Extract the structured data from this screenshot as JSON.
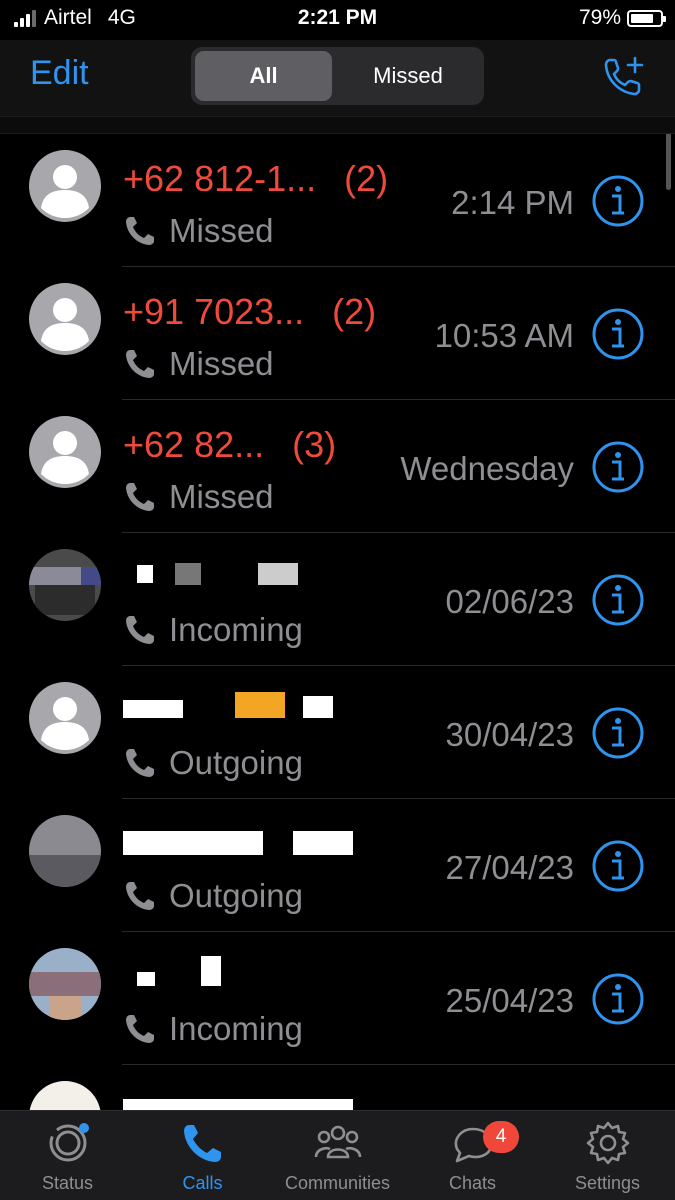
{
  "status_bar": {
    "carrier": "Airtel",
    "network": "4G",
    "time": "2:21 PM",
    "battery": "79%",
    "battery_level": 0.79
  },
  "header": {
    "edit_label": "Edit",
    "segments": [
      "All",
      "Missed"
    ],
    "selected_segment": "All",
    "new_call_icon": "add-call-icon"
  },
  "calls": [
    {
      "name": "+62 812-1...",
      "count": "(2)",
      "type": "Missed",
      "time": "2:14 PM",
      "missed": true
    },
    {
      "name": "+91 7023...",
      "count": "(2)",
      "type": "Missed",
      "time": "10:53 AM",
      "missed": true
    },
    {
      "name": "+62 82...",
      "count": "(3)",
      "type": "Missed",
      "time": "Wednesday",
      "missed": true
    },
    {
      "name": "",
      "count": "",
      "type": "Incoming",
      "time": "02/06/23",
      "missed": false
    },
    {
      "name": "",
      "count": "",
      "type": "Outgoing",
      "time": "30/04/23",
      "missed": false
    },
    {
      "name": "",
      "count": "",
      "type": "Outgoing",
      "time": "27/04/23",
      "missed": false
    },
    {
      "name": "",
      "count": "",
      "type": "Incoming",
      "time": "25/04/23",
      "missed": false
    }
  ],
  "tabs": [
    {
      "label": "Status",
      "icon": "status-icon"
    },
    {
      "label": "Calls",
      "icon": "phone-icon",
      "active": true
    },
    {
      "label": "Communities",
      "icon": "communities-icon"
    },
    {
      "label": "Chats",
      "icon": "chats-icon",
      "badge": "4"
    },
    {
      "label": "Settings",
      "icon": "gear-icon"
    }
  ],
  "colors": {
    "accent": "#2f94ee",
    "missed": "#f04a3c",
    "secondary_text": "#8e8e93",
    "background": "#000000"
  }
}
